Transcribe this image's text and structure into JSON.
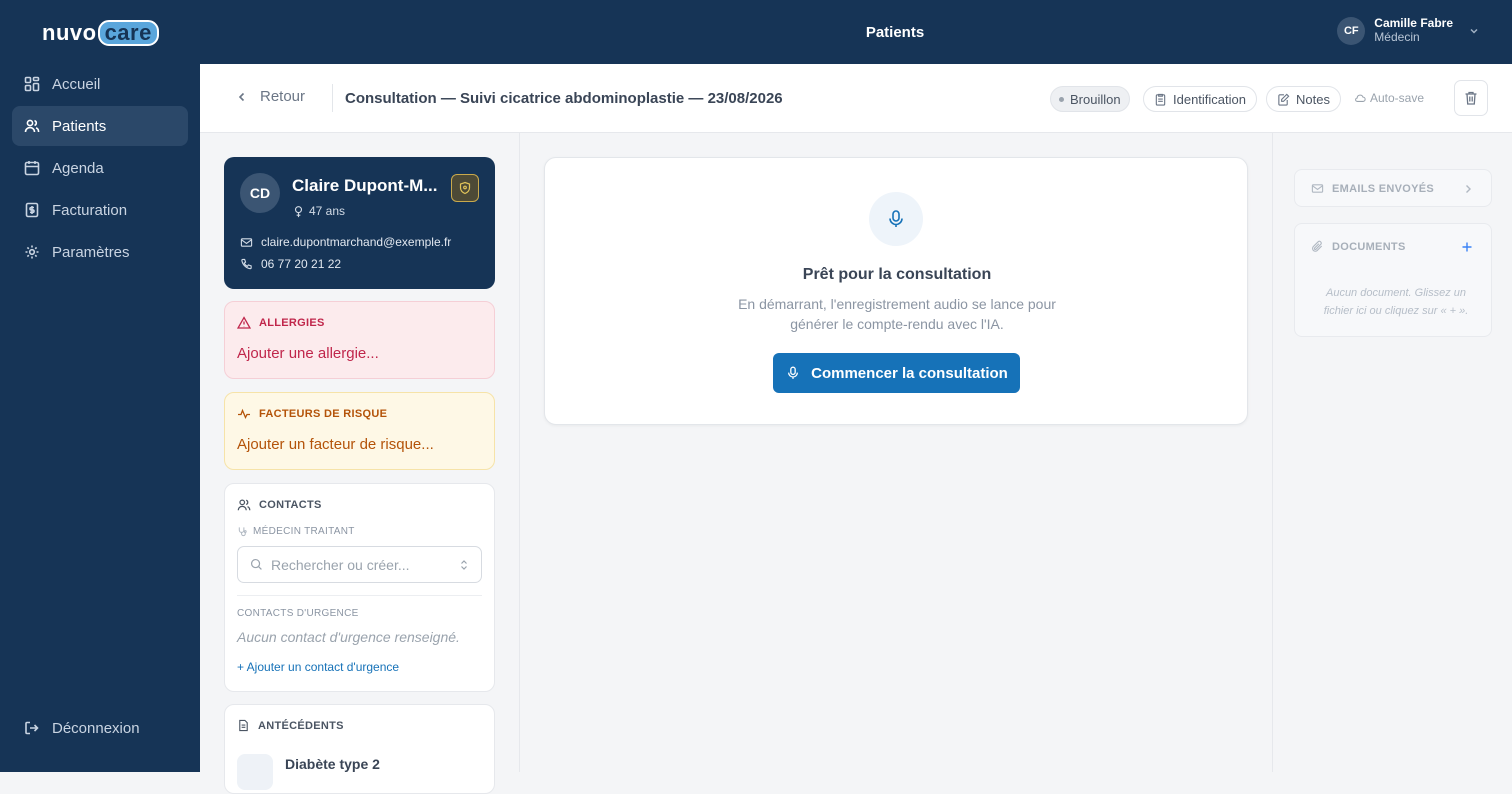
{
  "brand": {
    "part1": "nuvo",
    "part2": "care"
  },
  "topbar": {
    "title": "Patients"
  },
  "user": {
    "initials": "CF",
    "name": "Camille Fabre",
    "role": "Médecin"
  },
  "sidebar": {
    "items": [
      {
        "label": "Accueil",
        "icon": "dashboard-icon"
      },
      {
        "label": "Patients",
        "icon": "users-icon",
        "active": true
      },
      {
        "label": "Agenda",
        "icon": "calendar-icon"
      },
      {
        "label": "Facturation",
        "icon": "invoice-icon"
      },
      {
        "label": "Paramètres",
        "icon": "gear-icon"
      }
    ],
    "logout": "Déconnexion"
  },
  "header": {
    "back": "Retour",
    "title": "Consultation — Suivi cicatrice abdominoplastie — 23/08/2026",
    "status": "Brouillon",
    "identification": "Identification",
    "notes": "Notes",
    "autosave": "Auto-save"
  },
  "patient": {
    "initials": "CD",
    "name": "Claire Dupont-M...",
    "age": "47 ans",
    "email": "claire.dupontmarchand@exemple.fr",
    "phone": "06 77 20 21 22"
  },
  "allergies": {
    "title": "ALLERGIES",
    "add": "Ajouter une allergie...",
    "color": "#c0264b"
  },
  "risks": {
    "title": "FACTEURS DE RISQUE",
    "add": "Ajouter un facteur de risque...",
    "color": "#b45309"
  },
  "contacts": {
    "title": "CONTACTS",
    "doctor_label": "MÉDECIN TRAITANT",
    "search_placeholder": "Rechercher ou créer...",
    "emergency_label": "CONTACTS D'URGENCE",
    "emergency_empty": "Aucun contact d'urgence renseigné.",
    "add_emergency": "+ Ajouter un contact d'urgence"
  },
  "history": {
    "title": "ANTÉCÉDENTS",
    "first_item": "Diabète type 2"
  },
  "consultation": {
    "ready_title": "Prêt pour la consultation",
    "ready_text": "En démarrant, l'enregistrement audio se lance pour générer le compte-rendu avec l'IA.",
    "start_button": "Commencer la consultation",
    "accent": "#1672b8"
  },
  "right": {
    "emails_title": "EMAILS ENVOYÉS",
    "documents_title": "DOCUMENTS",
    "documents_empty": "Aucun document. Glissez un fichier ici ou cliquez sur « + »."
  }
}
